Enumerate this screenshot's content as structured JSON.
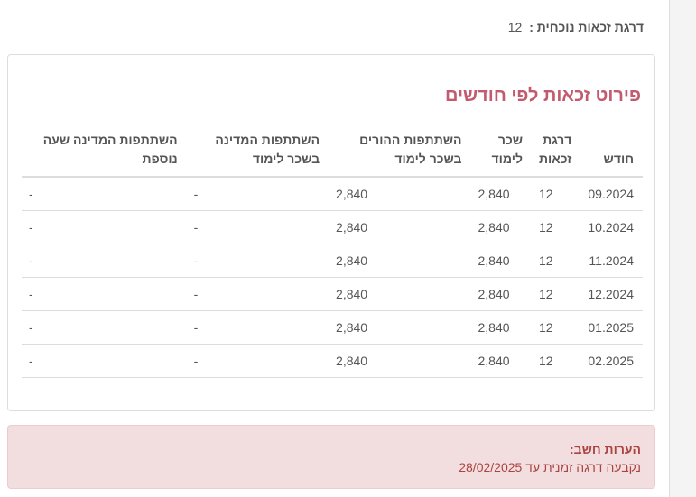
{
  "current_level": {
    "label": "דרגת זכאות נוכחית :",
    "value": "12"
  },
  "breakdown": {
    "title": "פירוט זכאות לפי חודשים",
    "columns": [
      "חודש",
      "דרגת זכאות",
      "שכר לימוד",
      "השתתפות ההורים בשכר לימוד",
      "השתתפות המדינה בשכר לימוד",
      "השתתפות המדינה שעה נוספת"
    ],
    "rows": [
      {
        "month": "09.2024",
        "level": "12",
        "tuition": "2,840",
        "parents": "2,840",
        "state": "-",
        "extra_hour": "-"
      },
      {
        "month": "10.2024",
        "level": "12",
        "tuition": "2,840",
        "parents": "2,840",
        "state": "-",
        "extra_hour": "-"
      },
      {
        "month": "11.2024",
        "level": "12",
        "tuition": "2,840",
        "parents": "2,840",
        "state": "-",
        "extra_hour": "-"
      },
      {
        "month": "12.2024",
        "level": "12",
        "tuition": "2,840",
        "parents": "2,840",
        "state": "-",
        "extra_hour": "-"
      },
      {
        "month": "01.2025",
        "level": "12",
        "tuition": "2,840",
        "parents": "2,840",
        "state": "-",
        "extra_hour": "-"
      },
      {
        "month": "02.2025",
        "level": "12",
        "tuition": "2,840",
        "parents": "2,840",
        "state": "-",
        "extra_hour": "-"
      }
    ]
  },
  "notes": {
    "title": "הערות חשב:",
    "text": "נקבעה דרגה זמנית עד 28/02/2025"
  },
  "colors": {
    "title_accent": "#c25b6f",
    "alert_bg": "#f2dede",
    "alert_text": "#a94442"
  }
}
